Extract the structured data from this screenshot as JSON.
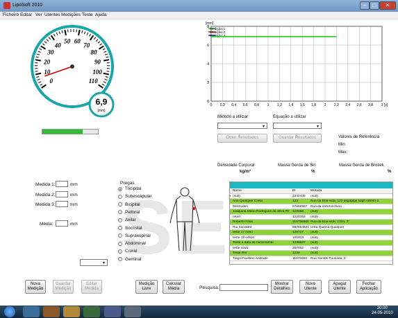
{
  "window": {
    "title": "LipoSoft 2010"
  },
  "menu": [
    "Ficheiro",
    "Editar",
    "Ver",
    "Utentes",
    "Medições",
    "Teste",
    "Ajuda"
  ],
  "gauge": {
    "value_text": "6,9",
    "unit": "[mm]",
    "ticks": [
      "0",
      "10",
      "20",
      "30",
      "40",
      "50",
      "60",
      "70",
      "80",
      "90",
      "100",
      "110"
    ],
    "needle_value": 6.9,
    "progress": 0.72
  },
  "chart_data": {
    "type": "line",
    "ylabel": "[mm]",
    "xlabel": "[s]",
    "xlim": [
      0,
      3
    ],
    "ylim": [
      0,
      8
    ],
    "xticks": [
      "0",
      "0,2",
      "0,4",
      "0,6",
      "0,8",
      "1",
      "1,2",
      "1,4",
      "1,6",
      "1,8",
      "2",
      "2,2",
      "2,4",
      "2,6",
      "2,8",
      "3"
    ],
    "yticks": [
      "0",
      "2",
      "4",
      "6",
      "8"
    ],
    "legend": [
      "Medição 1",
      "Medição 2",
      "Medição 3"
    ],
    "legend_colors": [
      "#22cc22",
      "#cc2222",
      "#2233cc"
    ],
    "series": [
      {
        "name": "Medição 1",
        "color": "#22cc22",
        "points": [
          [
            0,
            6.9
          ],
          [
            2.2,
            6.9
          ]
        ]
      }
    ]
  },
  "methods": {
    "method_label": "Método a utilizar",
    "equation_label": "Equação a utilizar",
    "obtain_button": "Obter Resultados",
    "save_results_button": "Guardar Resultados"
  },
  "reference": {
    "title": "Valores de Referência",
    "min": "Min:",
    "max": "Max:"
  },
  "results": {
    "density_label": "Densidade Corporal",
    "density_unit": "kg/m³",
    "siri_label": "Massa Gorda de Siri",
    "siri_unit": "%",
    "brozek_label": "Massa Gorda de Brozek",
    "brozek_unit": "%"
  },
  "measures": {
    "m1": "Medida 1:",
    "m2": "Medida 2:",
    "m3": "Medida 3:",
    "avg": "Média:",
    "unit": "mm"
  },
  "pregas": {
    "title": "Pregas",
    "items": [
      "Tricipital",
      "Subescapular",
      "Bicipital",
      "Peitoral",
      "Axilar",
      "Iliocristal",
      "Supraespinal",
      "Abdominal",
      "Crural",
      "Geminal"
    ],
    "selected": 0
  },
  "table": {
    "headers": [
      "Nome",
      "BI",
      "Morada"
    ],
    "rows": [
      {
        "nome": "(null)",
        "bi": "2342435",
        "morada": "(null)",
        "hl": false,
        "cur": true
      },
      {
        "nome": "Ana Qualquer Coisa",
        "bi": "123",
        "morada": "Rua da Boa-vida, 123 dsgdgfgs sdgff rdfrrsh d",
        "hl": true
      },
      {
        "nome": "Desfrudes",
        "bi": "67568967",
        "morada": "Rua da conchinchina",
        "hl": false
      },
      {
        "nome": "Joaquina Maria Rodrigues da Silva Pe",
        "bi": "123456",
        "morada": "(null)",
        "hl": true
      },
      {
        "nome": "retert",
        "bi": "1224353",
        "morada": "(null)",
        "hl": false
      },
      {
        "nome": "Roberto Frias",
        "bi": "110756560",
        "morada": "Rua da Boa-vida, 1324, 2º",
        "hl": true
      },
      {
        "nome": "Rui Salvador",
        "bi": "887654321",
        "morada": "Urba Quinha Qualquer",
        "hl": false
      },
      {
        "nome": "teste 17 meio",
        "bi": "125717",
        "morada": "(null)",
        "hl": true
      },
      {
        "nome": "teste 18 ossos",
        "bi": "181018",
        "morada": "(null)",
        "hl": false
      },
      {
        "nome": "Teste a data de nascimento",
        "bi": "1236587",
        "morada": "(null)",
        "hl": true
      },
      {
        "nome": "teste novo",
        "bi": "287462",
        "morada": "(null)",
        "hl": false
      },
      {
        "nome": "Teste Rei",
        "bi": "1234",
        "morada": "(null)",
        "hl": true
      },
      {
        "nome": "Tiago Faustino Andrade",
        "bi": "11076658",
        "morada": "Rua Santos Pousada, 2",
        "hl": false
      }
    ]
  },
  "bottom": {
    "new_measure": "Nova Medição",
    "save_measure": "Guardar Medição",
    "edit_measure": "Editar Medida",
    "free_measure": "Medição Livre",
    "calc_avg": "Calcular Média",
    "search_label": "Pesquisa:",
    "show_details": "Mostrar Detalhes",
    "new_patient": "Novo Utente",
    "delete_patient": "Apagar Utente",
    "close_app": "Fechar Aplicação"
  },
  "watermark": "SEITE",
  "taskbar": {
    "time": "20:00",
    "date": "24-05-2010"
  },
  "colors": {
    "row_highlight": "#8fd23a",
    "table_header": "#1bb7c4",
    "gauge_border": "#1aa5a8"
  }
}
